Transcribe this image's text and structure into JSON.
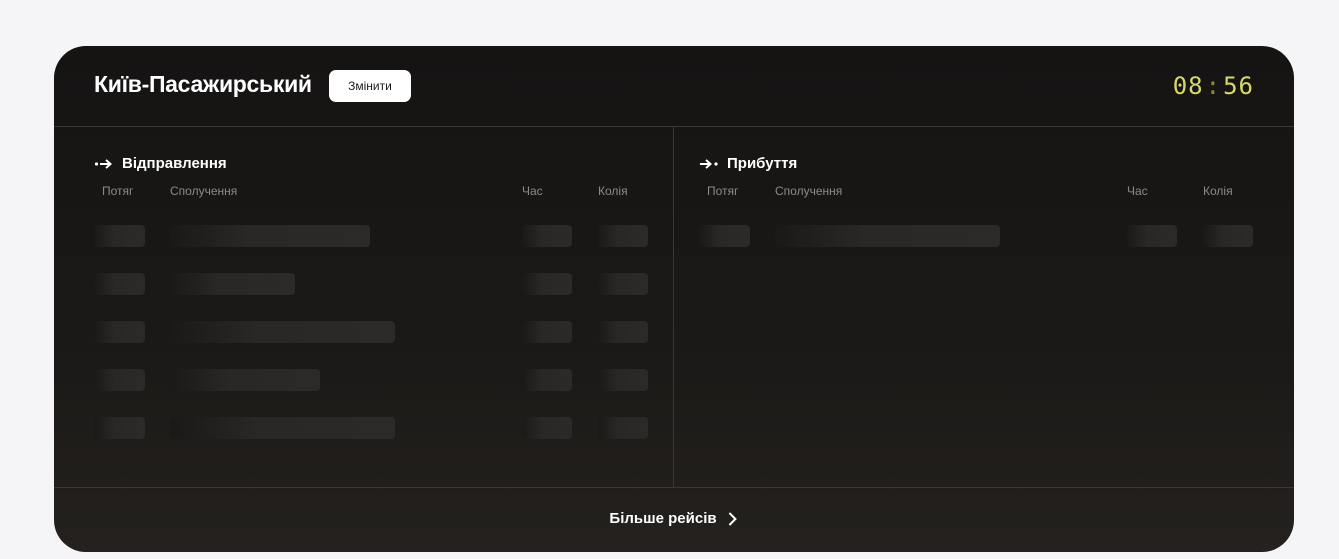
{
  "header": {
    "station": "Київ-Пасажирський",
    "change_label": "Змінити",
    "clock_hours": "08",
    "clock_sep": ":",
    "clock_minutes": "56"
  },
  "departures": {
    "title": "Відправлення",
    "icon": "departure-arrow-icon",
    "columns": {
      "train": "Потяг",
      "route": "Сполучення",
      "time": "Час",
      "track": "Колія"
    },
    "loading_rows": 5
  },
  "arrivals": {
    "title": "Прибуття",
    "icon": "arrival-arrow-icon",
    "columns": {
      "train": "Потяг",
      "route": "Сполучення",
      "time": "Час",
      "track": "Колія"
    },
    "loading_rows": 1
  },
  "footer": {
    "more_label": "Більше рейсів",
    "icon": "chevron-right-icon"
  },
  "colors": {
    "board_bg": "#1b1917",
    "clock": "#d8d86a",
    "page_bg": "#f5f5f7"
  }
}
